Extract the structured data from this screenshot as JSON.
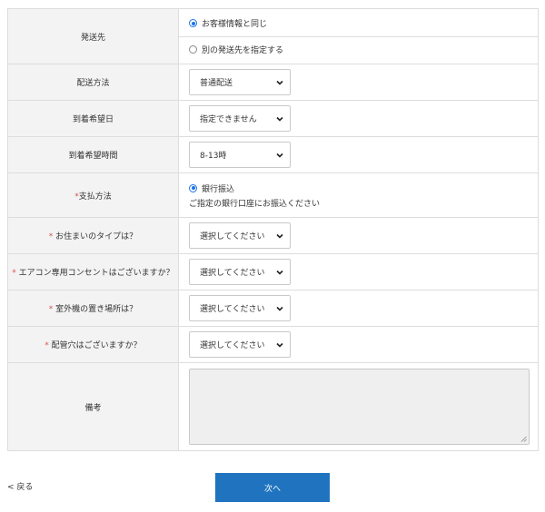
{
  "shipping": {
    "label": "発送先",
    "options": [
      {
        "label": "お客様情報と同じ",
        "checked": true
      },
      {
        "label": "別の発送先を指定する",
        "checked": false
      }
    ]
  },
  "delivery_method": {
    "label": "配送方法",
    "value": "普通配送"
  },
  "delivery_date": {
    "label": "到着希望日",
    "value": "指定できません"
  },
  "delivery_time": {
    "label": "到着希望時間",
    "value": "8-13時"
  },
  "payment": {
    "required_mark": "*",
    "label": "支払方法",
    "option": "銀行振込",
    "description": "ご指定の銀行口座にお振込ください"
  },
  "housing_type": {
    "required_mark": "*",
    "label": "お住まいのタイプは？",
    "value": "選択してください"
  },
  "outlet": {
    "required_mark": "*",
    "label": "エアコン専用コンセントはございますか？",
    "value": "選択してください"
  },
  "outdoor_unit": {
    "required_mark": "*",
    "label": "室外機の置き場所は？",
    "value": "選択してください"
  },
  "pipe_hole": {
    "required_mark": "*",
    "label": "配管穴はございますか？",
    "value": "選択してください"
  },
  "remarks": {
    "label": "備考",
    "value": ""
  },
  "nav": {
    "back_label": "< 戻る",
    "next_label": "次へ"
  },
  "colors": {
    "primary_button": "#1f73bf",
    "required": "#d9534f",
    "radio_checked": "#1a73e8"
  }
}
